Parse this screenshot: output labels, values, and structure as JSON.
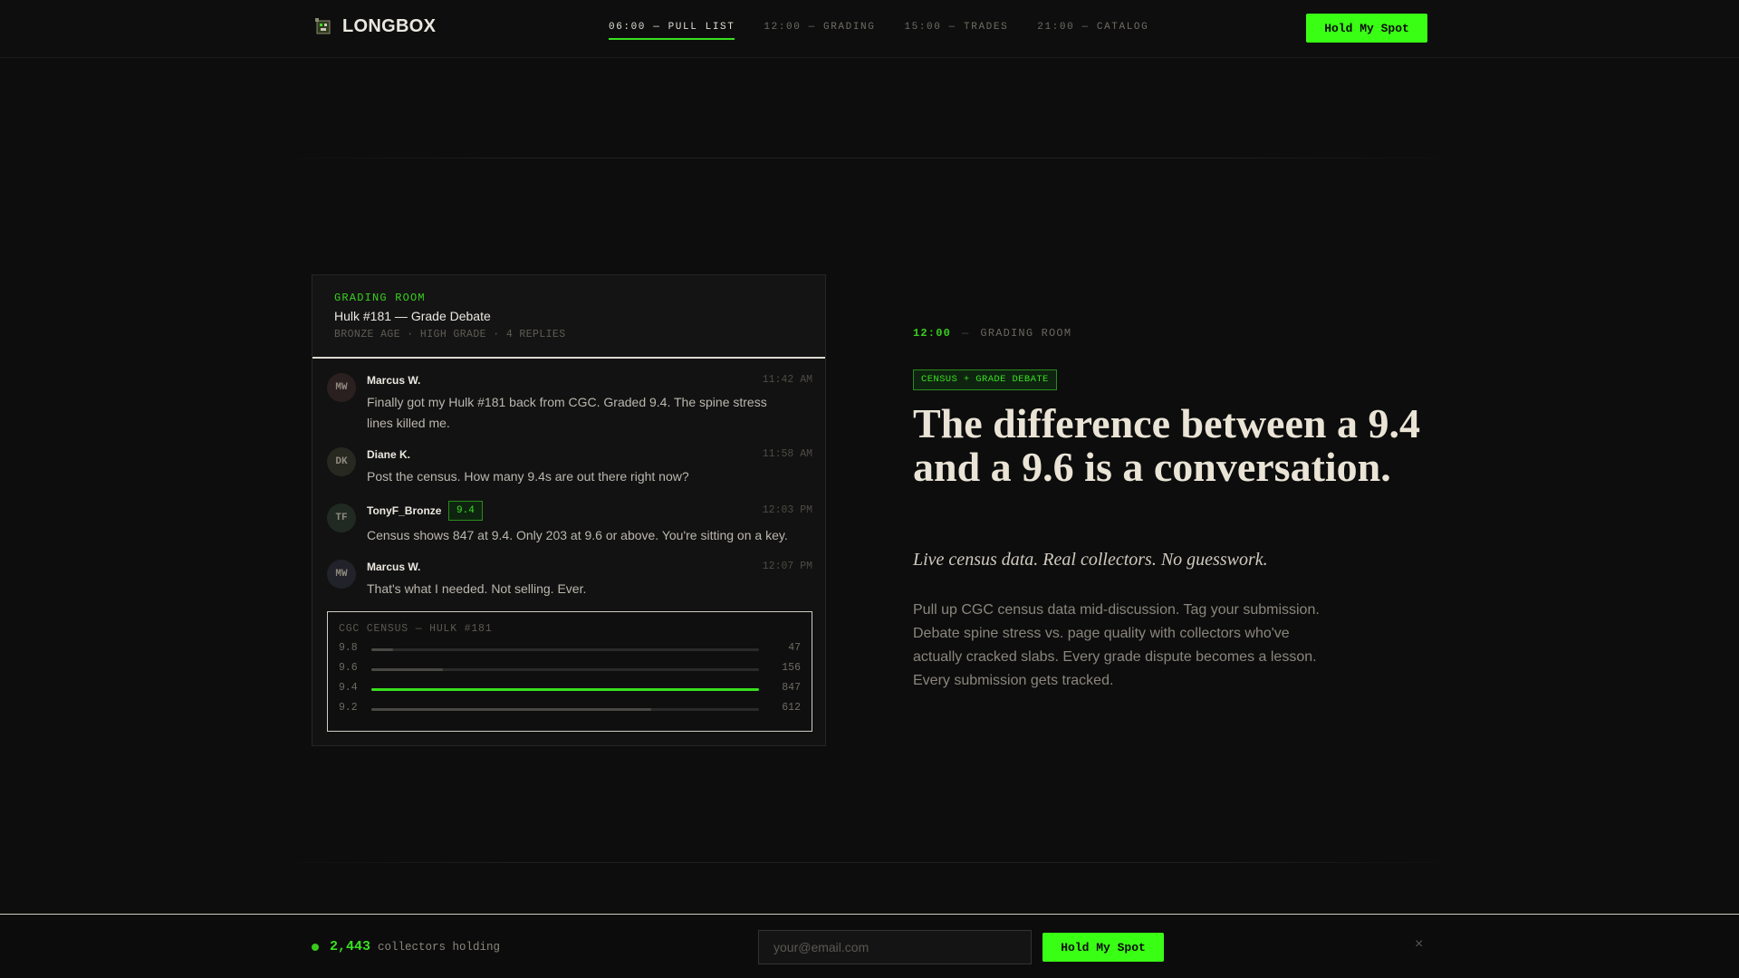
{
  "header": {
    "brand": "LONGBOX",
    "nav": [
      {
        "label": "06:00 — PULL LIST",
        "active": true
      },
      {
        "label": "12:00 — GRADING",
        "active": false
      },
      {
        "label": "15:00 — TRADES",
        "active": false
      },
      {
        "label": "21:00 — CATALOG",
        "active": false
      }
    ],
    "cta_label": "Hold My Spot"
  },
  "thread": {
    "label": "GRADING ROOM",
    "title": "Hulk #181 — Grade Debate",
    "meta": "BRONZE AGE · HIGH GRADE · 4 REPLIES",
    "messages": [
      {
        "initials": "MW",
        "author": "Marcus W.",
        "time": "11:42 AM",
        "text": "Finally got my Hulk #181 back from CGC. Graded 9.4. The spine stress lines killed me."
      },
      {
        "initials": "DK",
        "author": "Diane K.",
        "time": "11:58 AM",
        "text": "Post the census. How many 9.4s are out there right now?"
      },
      {
        "initials": "TF",
        "author": "TonyF_Bronze",
        "badge": "9.4",
        "time": "12:03 PM",
        "text": "Census shows 847 at 9.4. Only 203 at 9.6 or above. You're sitting on a key."
      },
      {
        "initials": "MW",
        "author": "Marcus W.",
        "time": "12:07 PM",
        "text": "That's what I needed. Not selling. Ever."
      }
    ],
    "census": {
      "title": "CGC CENSUS — HULK #181",
      "rows": [
        {
          "grade": "9.8",
          "count": "47",
          "value": 47
        },
        {
          "grade": "9.6",
          "count": "156",
          "value": 156
        },
        {
          "grade": "9.4",
          "count": "847",
          "value": 847
        },
        {
          "grade": "9.2",
          "count": "612",
          "value": 612
        }
      ],
      "highlight_grade": "9.4",
      "accent_color": "#39e11f"
    }
  },
  "hero": {
    "time": "12:00",
    "dash": "—",
    "section": "GRADING ROOM",
    "tag": "CENSUS + GRADE DEBATE",
    "headline": "The difference between a 9.4 and a 9.6 is a conversation.",
    "subhead": "Live census data. Real collectors. No guesswork.",
    "body": "Pull up CGC census data mid-discussion. Tag your submission. Debate spine stress vs. page quality with collectors who've actually cracked slabs. Every grade dispute becomes a lesson. Every submission gets tracked."
  },
  "bottom_bar": {
    "count": "2,443",
    "count_label": "collectors holding",
    "email_placeholder": "your@email.com",
    "cta_label": "Hold My Spot",
    "close_icon": "×"
  },
  "colors": {
    "accent": "#39ff14",
    "background": "#0d0d0d"
  }
}
